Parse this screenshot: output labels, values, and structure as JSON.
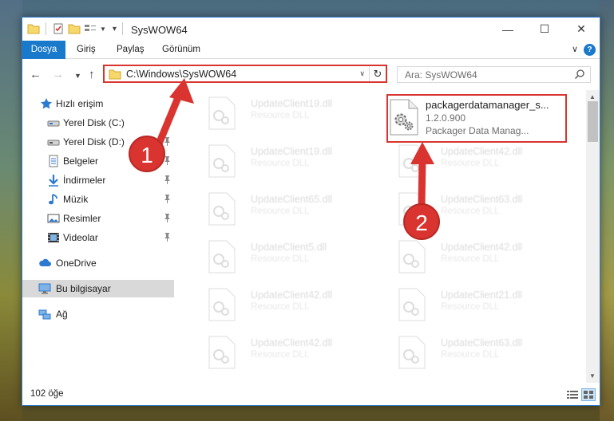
{
  "window": {
    "title": "SysWOW64",
    "controls": {
      "minimize": "—",
      "maximize": "☐",
      "close": "✕"
    }
  },
  "ribbon": {
    "tabs": [
      "Dosya",
      "Giriş",
      "Paylaş",
      "Görünüm"
    ],
    "help": "?"
  },
  "address": {
    "path": "C:\\Windows\\SysWOW64"
  },
  "search": {
    "placeholder": "Ara: SysWOW64"
  },
  "sidebar": {
    "items": [
      {
        "label": "Hızlı erişim",
        "icon": "star-icon",
        "pinned": false
      },
      {
        "label": "Yerel Disk (C:)",
        "icon": "drive-icon",
        "pinned": true
      },
      {
        "label": "Yerel Disk (D:)",
        "icon": "drive-icon",
        "pinned": true
      },
      {
        "label": "Belgeler",
        "icon": "documents-icon",
        "pinned": true
      },
      {
        "label": "İndirmeler",
        "icon": "download-icon",
        "pinned": true
      },
      {
        "label": "Müzik",
        "icon": "music-icon",
        "pinned": true
      },
      {
        "label": "Resimler",
        "icon": "pictures-icon",
        "pinned": true
      },
      {
        "label": "Videolar",
        "icon": "video-icon",
        "pinned": true
      },
      {
        "label": "OneDrive",
        "icon": "cloud-icon",
        "pinned": false
      },
      {
        "label": "Bu bilgisayar",
        "icon": "computer-icon",
        "pinned": false
      },
      {
        "label": "Ağ",
        "icon": "network-icon",
        "pinned": false
      }
    ]
  },
  "files": {
    "highlighted": {
      "name": "packagerdatamanager_s...",
      "version": "1.2.0.900",
      "description": "Packager Data Manag..."
    },
    "left_column": [
      {
        "name": "UpdateClient19.dll",
        "desc": "Resource DLL"
      },
      {
        "name": "UpdateClient19.dll",
        "desc": "Resource DLL"
      },
      {
        "name": "UpdateClient65.dll",
        "desc": "Resource DLL"
      },
      {
        "name": "UpdateClient5.dll",
        "desc": "Resource DLL"
      },
      {
        "name": "UpdateClient42.dll",
        "desc": "Resource DLL"
      },
      {
        "name": "UpdateClient42.dll",
        "desc": "Resource DLL"
      }
    ],
    "right_column": [
      {
        "name": "UpdateClient42.dll",
        "desc": "Resource DLL"
      },
      {
        "name": "UpdateClient63.dll",
        "desc": "Resource DLL"
      },
      {
        "name": "UpdateClient42.dll",
        "desc": "Resource DLL"
      },
      {
        "name": "UpdateClient21.dll",
        "desc": "Resource DLL"
      },
      {
        "name": "UpdateClient63.dll",
        "desc": "Resource DLL"
      }
    ]
  },
  "status": {
    "item_count": "102 öğe"
  },
  "callouts": [
    "1",
    "2"
  ],
  "colors": {
    "accent": "#1979ca",
    "annotation_red": "#d9342f",
    "selection": "#d9d9d9"
  }
}
